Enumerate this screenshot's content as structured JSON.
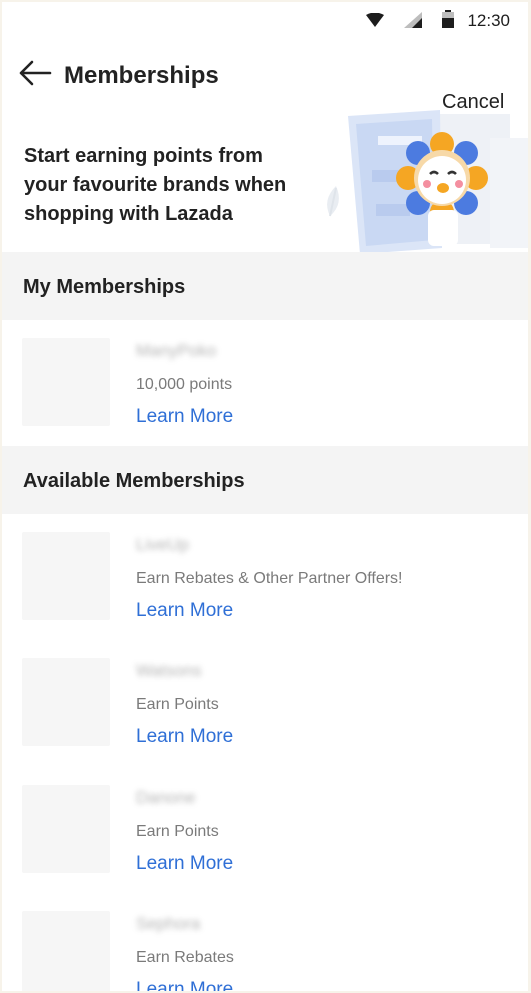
{
  "status_bar": {
    "time": "12:30"
  },
  "header": {
    "title": "Memberships",
    "cancel_label": "Cancel"
  },
  "promo": {
    "line1": "Start earning points from",
    "line2": "your favourite brands when",
    "line3": "shopping with Lazada"
  },
  "my_memberships": {
    "heading": "My Memberships",
    "items": [
      {
        "name": "ManyPoko",
        "desc": "10,000 points",
        "link": "Learn More"
      }
    ]
  },
  "available_memberships": {
    "heading": "Available Memberships",
    "items": [
      {
        "name": "LiveUp",
        "desc": "Earn Rebates & Other Partner Offers!",
        "link": "Learn More"
      },
      {
        "name": "Watsons",
        "desc": "Earn Points",
        "link": "Learn More"
      },
      {
        "name": "Danone",
        "desc": "Earn Points",
        "link": "Learn More"
      },
      {
        "name": "Sephora",
        "desc": "Earn Rebates",
        "link": "Learn More"
      }
    ]
  },
  "colors": {
    "link": "#2f6fd6",
    "section_bg": "#f4f4f4"
  }
}
